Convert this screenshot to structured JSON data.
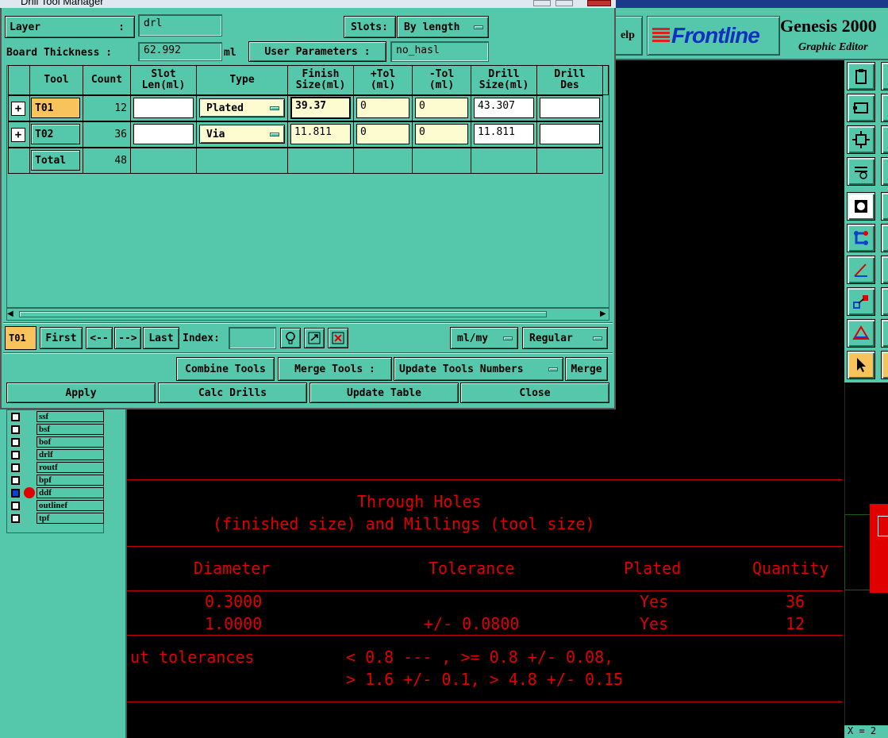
{
  "dialog": {
    "title": "Drill Tool Manager",
    "layer_label": "Layer",
    "layer_colon": ":",
    "layer_value": "drl",
    "slots_label": "Slots:",
    "slots_value": "By length",
    "board_thickness_label": "Board Thickness :",
    "board_thickness_value": "62.992",
    "board_thickness_unit": "ml",
    "user_params_label": "User Parameters :",
    "user_params_value": "no_hasl"
  },
  "table": {
    "headers": [
      {
        "line1": "Tool",
        "line2": ""
      },
      {
        "line1": "Count",
        "line2": ""
      },
      {
        "line1": "Slot",
        "line2": "Len(ml)"
      },
      {
        "line1": "Type",
        "line2": ""
      },
      {
        "line1": "Finish",
        "line2": "Size(ml)"
      },
      {
        "line1": "+Tol",
        "line2": "(ml)"
      },
      {
        "line1": "-Tol",
        "line2": "(ml)"
      },
      {
        "line1": "Drill",
        "line2": "Size(ml)"
      },
      {
        "line1": "Drill",
        "line2": "Des"
      }
    ],
    "rows": [
      {
        "tool": "T01",
        "count": "12",
        "slot_len": "",
        "type": "Plated",
        "finish": "39.37",
        "plus_tol": "0",
        "minus_tol": "0",
        "drill_size": "43.307",
        "drill_des": ""
      },
      {
        "tool": "T02",
        "count": "36",
        "slot_len": "",
        "type": "Via",
        "finish": "11.811",
        "plus_tol": "0",
        "minus_tol": "0",
        "drill_size": "11.811",
        "drill_des": ""
      }
    ],
    "total_label": "Total",
    "total_count": "48"
  },
  "nav": {
    "current_tool": "T01",
    "first": "First",
    "prev": "<--",
    "next": "-->",
    "last": "Last",
    "index_label": "Index:",
    "index_value": "",
    "units": "ml/my",
    "mode": "Regular"
  },
  "actions": {
    "combine": "Combine Tools",
    "merge_label": "Merge Tools :",
    "merge_option": "Update Tools Numbers",
    "merge": "Merge",
    "apply": "Apply",
    "calc": "Calc Drills",
    "update": "Update Table",
    "close": "Close"
  },
  "app": {
    "help": "elp",
    "logo": "Frontline",
    "title": "Genesis 2000",
    "subtitle": "Graphic Editor",
    "coord": "X = 2"
  },
  "layers": [
    {
      "name": "ssf",
      "active": false
    },
    {
      "name": "bsf",
      "active": false
    },
    {
      "name": "bof",
      "active": false
    },
    {
      "name": "drlf",
      "active": false
    },
    {
      "name": "routf",
      "active": false
    },
    {
      "name": "bpf",
      "active": false
    },
    {
      "name": "ddf",
      "active": true
    },
    {
      "name": "outlinef",
      "active": false
    },
    {
      "name": "tpf",
      "active": false
    }
  ],
  "drawing": {
    "heading1": "Through Holes",
    "heading2": "(finished size) and Millings (tool size)",
    "col_diameter": "Diameter",
    "col_tolerance": "Tolerance",
    "col_plated": "Plated",
    "col_quantity": "Quantity",
    "rows": [
      {
        "diameter": "0.3000",
        "tolerance": "",
        "plated": "Yes",
        "quantity": "36"
      },
      {
        "diameter": "1.0000",
        "tolerance": "+/- 0.0800",
        "plated": "Yes",
        "quantity": "12"
      }
    ],
    "note_label": "ut tolerances",
    "note_line1": "< 0.8   ---  , >= 0.8  +/- 0.08,",
    "note_line2": "> 1.6 +/- 0.1, >  4.8  +/- 0.15"
  },
  "colors": {
    "panel": "#55c8ac",
    "drawing_bg": "#000000",
    "drawing_text": "#e00000",
    "tool_selected": "#f7c35a",
    "input_yellow": "#fdfbd0"
  }
}
